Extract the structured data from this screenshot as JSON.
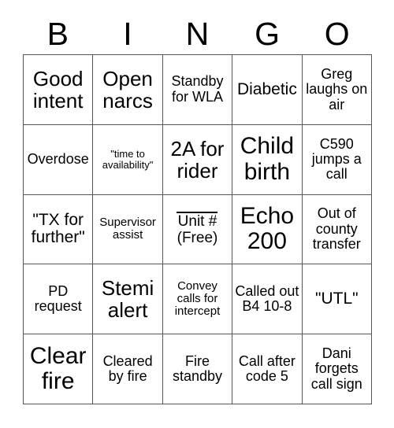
{
  "card": {
    "header_letters": [
      "B",
      "I",
      "N",
      "G",
      "O"
    ],
    "columns": 5,
    "rows": 5,
    "colors": {
      "background": "#ffffff",
      "text": "#000000",
      "grid_line": "#555555"
    },
    "cells": [
      {
        "text": "Good intent",
        "size": "lg",
        "free": false
      },
      {
        "text": "Open narcs",
        "size": "lg",
        "free": false
      },
      {
        "text": "Standby for WLA",
        "size": "sm",
        "free": false
      },
      {
        "text": "Diabetic",
        "size": "md",
        "free": false
      },
      {
        "text": "Greg laughs on air",
        "size": "sm",
        "free": false
      },
      {
        "text": "Overdose",
        "size": "sm",
        "free": false
      },
      {
        "text": "\"time to availability\"",
        "size": "xxs",
        "free": false
      },
      {
        "text": "2A for rider",
        "size": "lg",
        "free": false
      },
      {
        "text": "Child birth",
        "size": "xl",
        "free": false
      },
      {
        "text": "C590 jumps a call",
        "size": "sm",
        "free": false
      },
      {
        "text": "\"TX for further\"",
        "size": "md",
        "free": false
      },
      {
        "text": "Supervisor assist",
        "size": "xs",
        "free": false
      },
      {
        "text": "",
        "size": "sm",
        "free": true,
        "free_blank": "____",
        "free_unit": "Unit #",
        "free_label": "(Free)"
      },
      {
        "text": "Echo 200",
        "size": "xl",
        "free": false
      },
      {
        "text": "Out of county transfer",
        "size": "sm",
        "free": false
      },
      {
        "text": "PD request",
        "size": "sm",
        "free": false
      },
      {
        "text": "Stemi alert",
        "size": "lg",
        "free": false
      },
      {
        "text": "Convey calls for intercept",
        "size": "xs",
        "free": false
      },
      {
        "text": "Called out B4 10-8",
        "size": "sm",
        "free": false
      },
      {
        "text": "\"UTL\"",
        "size": "md",
        "free": false
      },
      {
        "text": "Clear fire",
        "size": "xl",
        "free": false
      },
      {
        "text": "Cleared by fire",
        "size": "sm",
        "free": false
      },
      {
        "text": "Fire standby",
        "size": "sm",
        "free": false
      },
      {
        "text": "Call after code 5",
        "size": "sm",
        "free": false
      },
      {
        "text": "Dani forgets call sign",
        "size": "sm",
        "free": false
      }
    ]
  }
}
